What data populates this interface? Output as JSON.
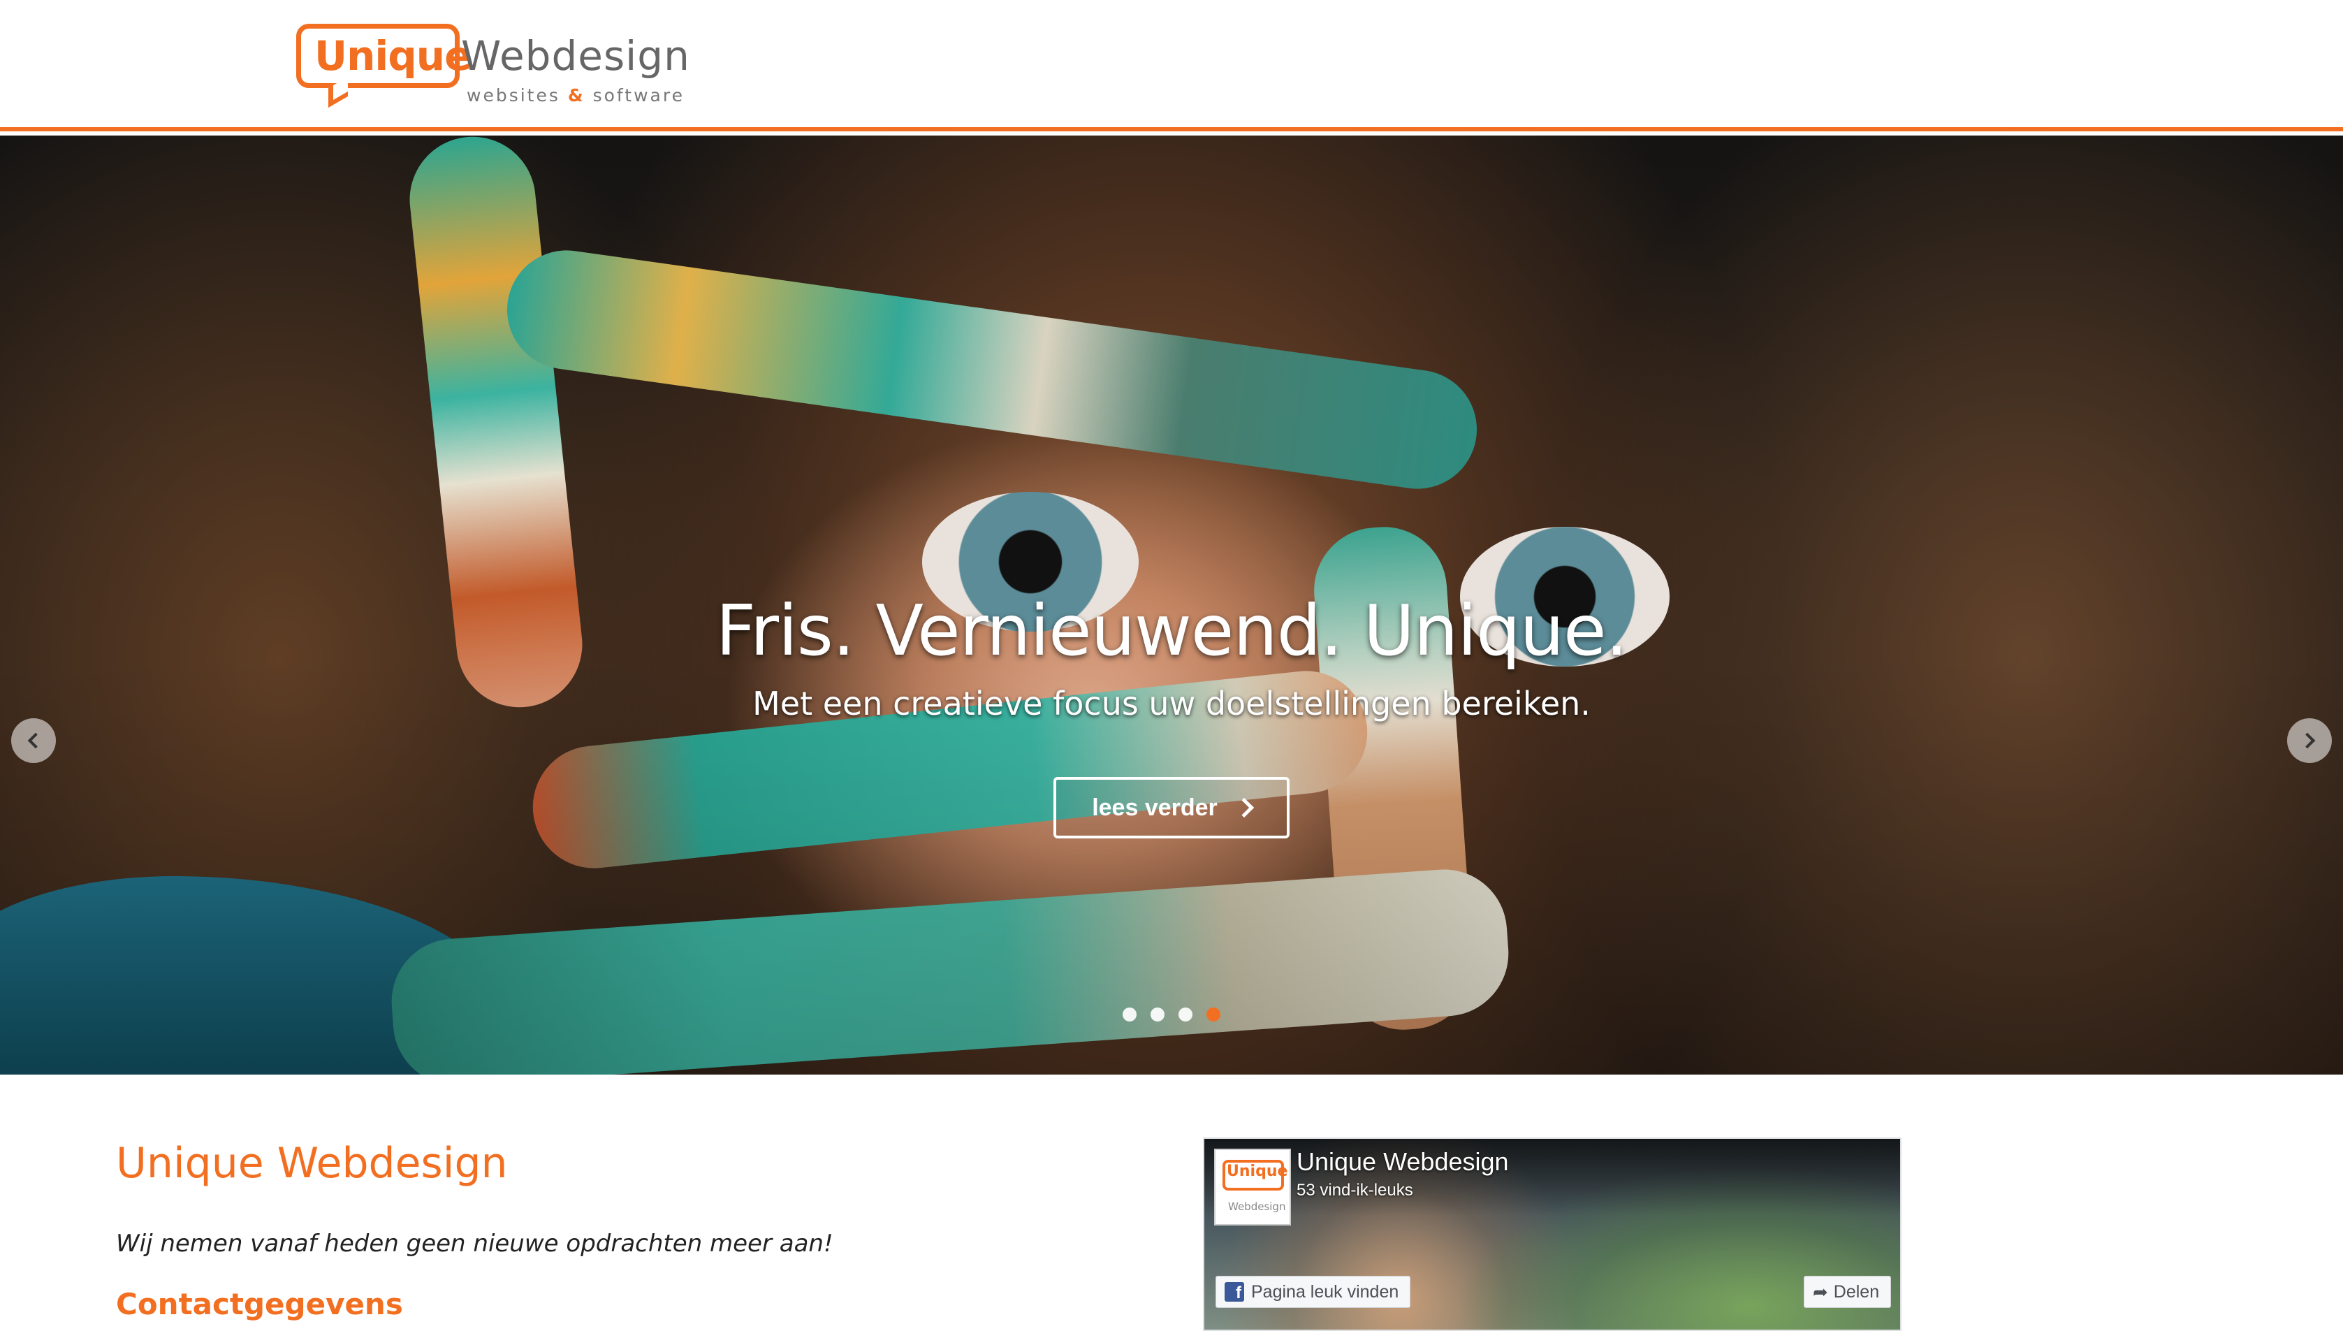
{
  "header": {
    "logo": {
      "unique": "Unique",
      "webdesign": "Webdesign",
      "tagline_prefix": "websites",
      "tagline_amp": "&",
      "tagline_suffix": "software"
    },
    "accent_color": "#f26f21"
  },
  "hero": {
    "title": "Fris. Vernieuwend. Unique.",
    "subtitle": "Met een creatieve focus uw doelstellingen bereiken.",
    "button_label": "lees verder",
    "button_icon": "chevron-right-icon",
    "slide_count": 4,
    "active_slide": 4,
    "prev_icon": "chevron-left-icon",
    "next_icon": "chevron-right-icon"
  },
  "content": {
    "title": "Unique Webdesign",
    "notice": "Wij nemen vanaf heden geen nieuwe opdrachten meer aan!",
    "section_heading": "Contactgegevens"
  },
  "facebook_widget": {
    "page_name": "Unique Webdesign",
    "likes": "53 vind-ik-leuks",
    "logo_text": "Unique",
    "logo_subtext": "Webdesign",
    "like_button": "Pagina leuk vinden",
    "share_button": "Delen",
    "brand_color": "#3b5998"
  }
}
